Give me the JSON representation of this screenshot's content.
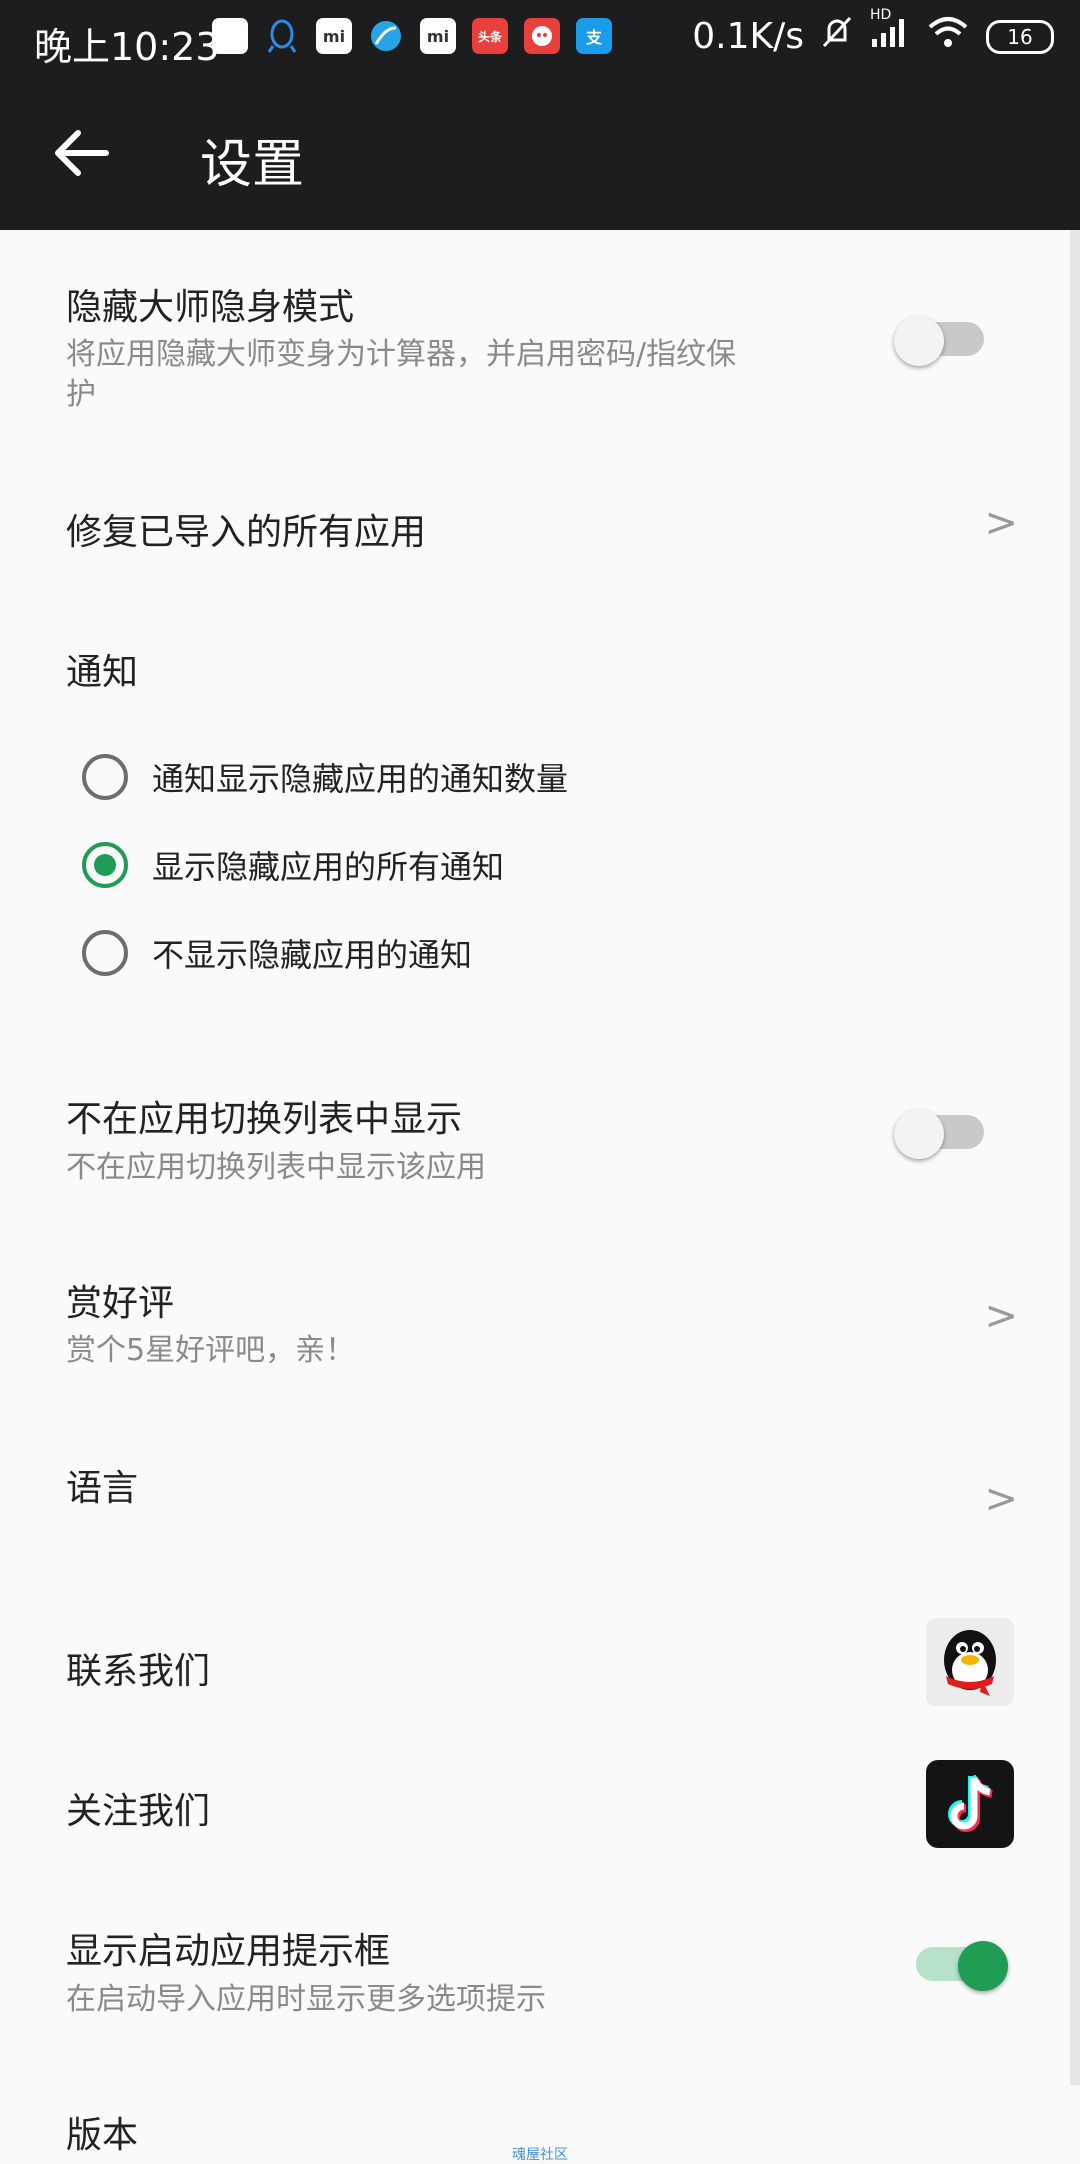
{
  "status_bar": {
    "time": "晚上10:23",
    "network_speed": "0.1K/s",
    "hd_label": "HD",
    "battery": "16",
    "apps": [
      {
        "name": "blank-app",
        "label": ""
      },
      {
        "name": "qq",
        "label": ""
      },
      {
        "name": "mi-store",
        "label": "mi"
      },
      {
        "name": "browser",
        "label": ""
      },
      {
        "name": "mi-store-2",
        "label": "mi"
      },
      {
        "name": "toutiao",
        "label": "头条"
      },
      {
        "name": "weibo",
        "label": ""
      },
      {
        "name": "alipay",
        "label": "支"
      }
    ]
  },
  "app_bar": {
    "title": "设置"
  },
  "settings": {
    "stealth_mode": {
      "title": "隐藏大师隐身模式",
      "subtitle_line1": "将应用隐藏大师变身为计算器，并启用密码/指纹保",
      "subtitle_line2": "护",
      "enabled": false
    },
    "repair_apps": {
      "title": "修复已导入的所有应用",
      "chevron": ">"
    },
    "notifications": {
      "title": "通知",
      "options": [
        {
          "label": "通知显示隐藏应用的通知数量",
          "checked": false
        },
        {
          "label": "显示隐藏应用的所有通知",
          "checked": true
        },
        {
          "label": "不显示隐藏应用的通知",
          "checked": false
        }
      ]
    },
    "hide_from_recents": {
      "title": "不在应用切换列表中显示",
      "subtitle": "不在应用切换列表中显示该应用",
      "enabled": false
    },
    "rate": {
      "title": "赏好评",
      "subtitle": "赏个5星好评吧，亲！",
      "chevron": ">"
    },
    "language": {
      "title": "语言",
      "chevron": ">"
    },
    "contact": {
      "title": "联系我们",
      "icon": "qq-icon"
    },
    "follow": {
      "title": "关注我们",
      "icon": "tiktok-icon"
    },
    "launch_prompt": {
      "title": "显示启动应用提示框",
      "subtitle": "在启动导入应用时显示更多选项提示",
      "enabled": true
    },
    "version": {
      "title": "版本"
    }
  },
  "watermark": "魂屋社区",
  "colors": {
    "accent": "#1f9d55",
    "toolbar": "#1d1d1f",
    "background": "#fafafa"
  }
}
